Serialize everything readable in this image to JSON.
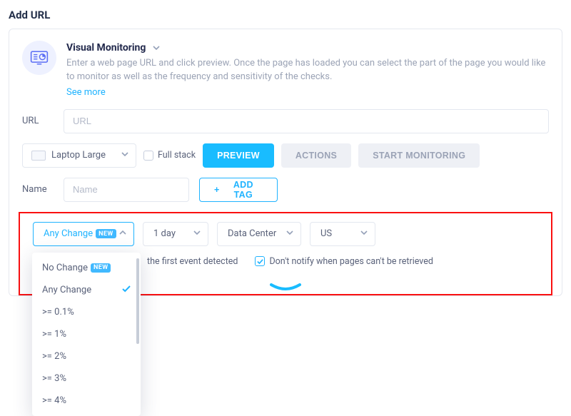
{
  "page_title": "Add URL",
  "header": {
    "title": "Visual Monitoring",
    "description": "Enter a web page URL and click preview. Once the page has loaded you can select the part of the page you would like to monitor as well as the frequency and sensitivity of the checks.",
    "see_more": "See more"
  },
  "url": {
    "label": "URL",
    "placeholder": "URL"
  },
  "toolbar": {
    "device": "Laptop Large",
    "full_stack": "Full stack",
    "preview": "PREVIEW",
    "actions": "ACTIONS",
    "start_monitoring": "START MONITORING"
  },
  "name": {
    "label": "Name",
    "placeholder": "Name",
    "add_tag": "ADD TAG"
  },
  "filters": {
    "change": {
      "label": "Any Change",
      "badge": "NEW"
    },
    "frequency": "1 day",
    "location_type": "Data Center",
    "location": "US"
  },
  "dropdown": {
    "items": [
      {
        "label": "No Change",
        "badge": "NEW",
        "selected": false
      },
      {
        "label": "Any Change",
        "selected": true
      },
      {
        "label": ">= 0.1%",
        "selected": false
      },
      {
        "label": ">= 1%",
        "selected": false
      },
      {
        "label": ">= 2%",
        "selected": false
      },
      {
        "label": ">= 3%",
        "selected": false
      },
      {
        "label": ">= 4%",
        "selected": false
      }
    ]
  },
  "options": {
    "suspend_after_first": "the first event detected",
    "dont_notify": "Don't notify when pages can't be retrieved"
  }
}
